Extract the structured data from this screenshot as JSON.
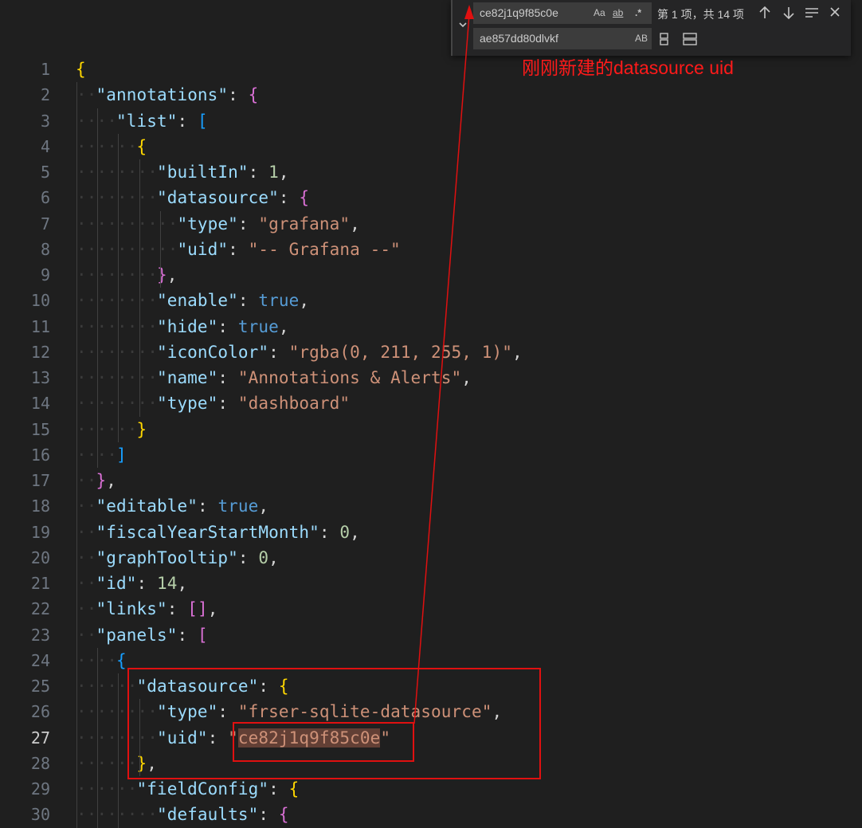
{
  "find_widget": {
    "search_value": "ce82j1q9f85c0e",
    "replace_value": "ae857dd80dlvkf",
    "match_case_label": "Aa",
    "whole_word_label": "ab",
    "regex_label": ".*",
    "preserve_case_label": "AB",
    "result_text": "第 1 项，共 14 项"
  },
  "annotation": {
    "caption": "刚刚新建的datasource uid"
  },
  "editor": {
    "active_line": 27,
    "lines": [
      {
        "n": "1",
        "indent": 0,
        "tokens": [
          [
            "{",
            "br1"
          ]
        ]
      },
      {
        "n": "2",
        "indent": 1,
        "tokens": [
          [
            "\"annotations\"",
            "k"
          ],
          [
            ": ",
            "p"
          ],
          [
            "{",
            "br2"
          ]
        ]
      },
      {
        "n": "3",
        "indent": 2,
        "tokens": [
          [
            "\"list\"",
            "k"
          ],
          [
            ": ",
            "p"
          ],
          [
            "[",
            "br3"
          ]
        ]
      },
      {
        "n": "4",
        "indent": 3,
        "tokens": [
          [
            "{",
            "br1"
          ]
        ]
      },
      {
        "n": "5",
        "indent": 4,
        "tokens": [
          [
            "\"builtIn\"",
            "k"
          ],
          [
            ": ",
            "p"
          ],
          [
            "1",
            "n"
          ],
          [
            ",",
            "p"
          ]
        ]
      },
      {
        "n": "6",
        "indent": 4,
        "tokens": [
          [
            "\"datasource\"",
            "k"
          ],
          [
            ": ",
            "p"
          ],
          [
            "{",
            "br2"
          ]
        ]
      },
      {
        "n": "7",
        "indent": 5,
        "tokens": [
          [
            "\"type\"",
            "k"
          ],
          [
            ": ",
            "p"
          ],
          [
            "\"grafana\"",
            "s"
          ],
          [
            ",",
            "p"
          ]
        ]
      },
      {
        "n": "8",
        "indent": 5,
        "tokens": [
          [
            "\"uid\"",
            "k"
          ],
          [
            ": ",
            "p"
          ],
          [
            "\"-- Grafana --\"",
            "s"
          ]
        ]
      },
      {
        "n": "9",
        "indent": 4,
        "tokens": [
          [
            "}",
            "br2"
          ],
          [
            ",",
            "p"
          ]
        ]
      },
      {
        "n": "10",
        "indent": 4,
        "tokens": [
          [
            "\"enable\"",
            "k"
          ],
          [
            ": ",
            "p"
          ],
          [
            "true",
            "b"
          ],
          [
            ",",
            "p"
          ]
        ]
      },
      {
        "n": "11",
        "indent": 4,
        "tokens": [
          [
            "\"hide\"",
            "k"
          ],
          [
            ": ",
            "p"
          ],
          [
            "true",
            "b"
          ],
          [
            ",",
            "p"
          ]
        ]
      },
      {
        "n": "12",
        "indent": 4,
        "tokens": [
          [
            "\"iconColor\"",
            "k"
          ],
          [
            ": ",
            "p"
          ],
          [
            "\"rgba(0, 211, 255, 1)\"",
            "s"
          ],
          [
            ",",
            "p"
          ]
        ]
      },
      {
        "n": "13",
        "indent": 4,
        "tokens": [
          [
            "\"name\"",
            "k"
          ],
          [
            ": ",
            "p"
          ],
          [
            "\"Annotations & Alerts\"",
            "s"
          ],
          [
            ",",
            "p"
          ]
        ]
      },
      {
        "n": "14",
        "indent": 4,
        "tokens": [
          [
            "\"type\"",
            "k"
          ],
          [
            ": ",
            "p"
          ],
          [
            "\"dashboard\"",
            "s"
          ]
        ]
      },
      {
        "n": "15",
        "indent": 3,
        "tokens": [
          [
            "}",
            "br1"
          ]
        ]
      },
      {
        "n": "16",
        "indent": 2,
        "tokens": [
          [
            "]",
            "br3"
          ]
        ]
      },
      {
        "n": "17",
        "indent": 1,
        "tokens": [
          [
            "}",
            "br2"
          ],
          [
            ",",
            "p"
          ]
        ]
      },
      {
        "n": "18",
        "indent": 1,
        "tokens": [
          [
            "\"editable\"",
            "k"
          ],
          [
            ": ",
            "p"
          ],
          [
            "true",
            "b"
          ],
          [
            ",",
            "p"
          ]
        ]
      },
      {
        "n": "19",
        "indent": 1,
        "tokens": [
          [
            "\"fiscalYearStartMonth\"",
            "k"
          ],
          [
            ": ",
            "p"
          ],
          [
            "0",
            "n"
          ],
          [
            ",",
            "p"
          ]
        ]
      },
      {
        "n": "20",
        "indent": 1,
        "tokens": [
          [
            "\"graphTooltip\"",
            "k"
          ],
          [
            ": ",
            "p"
          ],
          [
            "0",
            "n"
          ],
          [
            ",",
            "p"
          ]
        ]
      },
      {
        "n": "21",
        "indent": 1,
        "tokens": [
          [
            "\"id\"",
            "k"
          ],
          [
            ": ",
            "p"
          ],
          [
            "14",
            "n"
          ],
          [
            ",",
            "p"
          ]
        ]
      },
      {
        "n": "22",
        "indent": 1,
        "tokens": [
          [
            "\"links\"",
            "k"
          ],
          [
            ": ",
            "p"
          ],
          [
            "[]",
            "br2"
          ],
          [
            ",",
            "p"
          ]
        ]
      },
      {
        "n": "23",
        "indent": 1,
        "tokens": [
          [
            "\"panels\"",
            "k"
          ],
          [
            ": ",
            "p"
          ],
          [
            "[",
            "br2"
          ]
        ]
      },
      {
        "n": "24",
        "indent": 2,
        "tokens": [
          [
            "{",
            "br3"
          ]
        ]
      },
      {
        "n": "25",
        "indent": 3,
        "tokens": [
          [
            "\"datasource\"",
            "k"
          ],
          [
            ": ",
            "p"
          ],
          [
            "{",
            "br1"
          ]
        ]
      },
      {
        "n": "26",
        "indent": 4,
        "tokens": [
          [
            "\"type\"",
            "k"
          ],
          [
            ": ",
            "p"
          ],
          [
            "\"frser-sqlite-datasource\"",
            "s"
          ],
          [
            ",",
            "p"
          ]
        ]
      },
      {
        "n": "27",
        "indent": 4,
        "tokens": [
          [
            "\"uid\"",
            "k"
          ],
          [
            ": ",
            "p"
          ],
          [
            "\"",
            "s"
          ],
          [
            "ce82j1q9f85c0e",
            "s hl"
          ],
          [
            "\"",
            "s"
          ]
        ]
      },
      {
        "n": "28",
        "indent": 3,
        "tokens": [
          [
            "}",
            "br1"
          ],
          [
            ",",
            "p"
          ]
        ]
      },
      {
        "n": "29",
        "indent": 3,
        "tokens": [
          [
            "\"fieldConfig\"",
            "k"
          ],
          [
            ": ",
            "p"
          ],
          [
            "{",
            "br1"
          ]
        ]
      },
      {
        "n": "30",
        "indent": 4,
        "tokens": [
          [
            "\"defaults\"",
            "k"
          ],
          [
            ": ",
            "p"
          ],
          [
            "{",
            "br2"
          ]
        ]
      }
    ]
  }
}
